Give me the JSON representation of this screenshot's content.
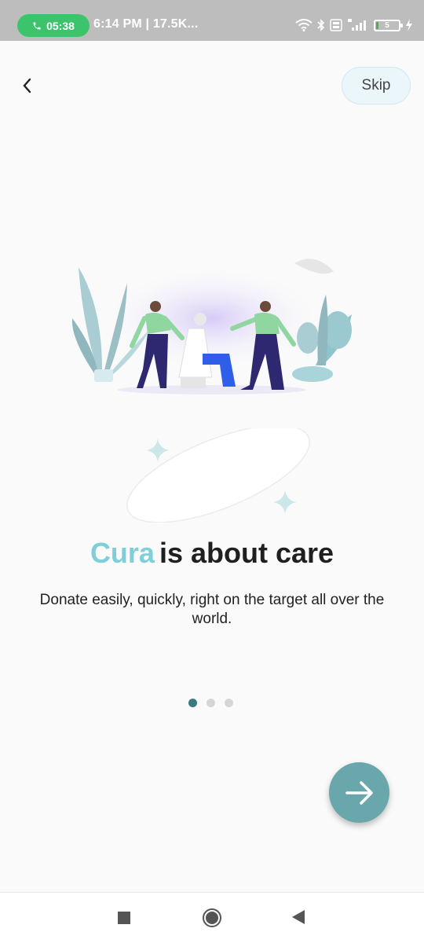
{
  "status_bar": {
    "call_time": "05:38",
    "info_text": "6:14 PM | 17.5K...",
    "battery_level": "5",
    "icons": [
      "phone-icon",
      "wifi-icon",
      "bluetooth-icon",
      "volte-icon",
      "signal-4g-icon",
      "battery-icon",
      "charging-icon"
    ]
  },
  "header": {
    "back_icon": "chevron-left-icon",
    "skip_label": "Skip"
  },
  "illustration": {
    "icon": "people-care-illustration"
  },
  "onboarding": {
    "brand": "Cura",
    "title_rest": "is about care",
    "subtitle": "Donate easily, quickly, right on the target all over the world.",
    "page_count": 3,
    "active_page": 1
  },
  "fab": {
    "icon": "arrow-right-icon"
  },
  "nav_bar": {
    "icons": [
      "recents-square-icon",
      "home-circle-icon",
      "back-triangle-icon"
    ]
  },
  "colors": {
    "brand_accent": "#7ecfd9",
    "fab": "#6aa7ad",
    "active_dot": "#3c7a82",
    "status_bar": "#bdbdbd",
    "call_pill": "#3cc46d"
  }
}
